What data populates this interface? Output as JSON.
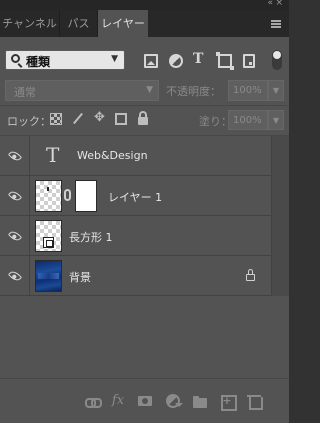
{
  "tabs": [
    {
      "label": "チャンネル",
      "active": false
    },
    {
      "label": "パス",
      "active": false
    },
    {
      "label": "レイヤー",
      "active": true
    }
  ],
  "window_controls": {
    "collapse": "«",
    "close": "×"
  },
  "filter": {
    "kind_label": "種類",
    "icons": [
      "pixel-layer-filter-icon",
      "adjustment-layer-filter-icon",
      "type-layer-filter-icon",
      "shape-layer-filter-icon",
      "smart-object-filter-icon"
    ]
  },
  "blend": {
    "mode": "通常",
    "opacity_label": "不透明度：",
    "opacity_value": "100%"
  },
  "lock": {
    "label": "ロック：",
    "fill_label": "塗り：",
    "fill_value": "100%"
  },
  "layers": [
    {
      "name": "Web&Design",
      "type": "text",
      "visible": true
    },
    {
      "name": "レイヤー 1",
      "type": "pixel-with-mask",
      "visible": true
    },
    {
      "name": "長方形 1",
      "type": "shape",
      "visible": true
    },
    {
      "name": "背景",
      "type": "background",
      "visible": true,
      "locked": true
    }
  ],
  "text_layer_glyph": "T",
  "footer_icons": [
    "link-layers-icon",
    "layer-style-fx-icon",
    "add-mask-icon",
    "new-adjustment-layer-icon",
    "new-group-icon",
    "new-layer-icon",
    "delete-layer-icon"
  ],
  "footer_fx_label": "fx",
  "colors": {
    "panel_bg": "#535353",
    "tab_bar_bg": "#282828",
    "active_tab_bg": "#535353",
    "text": "#e6e6e6",
    "disabled_text": "#8a8a8a"
  }
}
